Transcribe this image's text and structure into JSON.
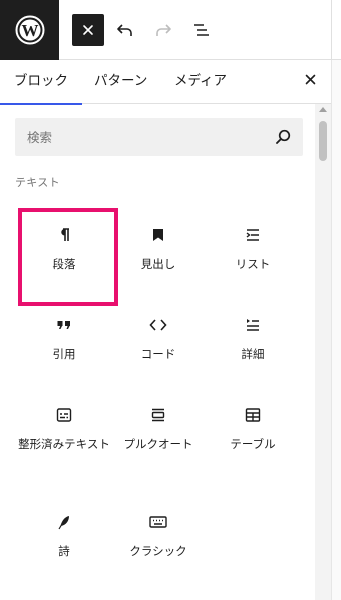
{
  "toolbar": {
    "logo_icon": "wordpress-logo-icon",
    "close_icon": "close-icon",
    "undo_icon": "undo-icon",
    "redo_icon": "redo-icon",
    "list_view_icon": "list-view-icon"
  },
  "tabs": [
    {
      "label": "ブロック",
      "active": true
    },
    {
      "label": "パターン",
      "active": false
    },
    {
      "label": "メディア",
      "active": false
    }
  ],
  "search": {
    "placeholder": "検索",
    "icon": "search-icon"
  },
  "category_label": "テキスト",
  "blocks": [
    {
      "label": "段落",
      "icon": "paragraph-icon",
      "selected": true
    },
    {
      "label": "見出し",
      "icon": "heading-bookmark-icon"
    },
    {
      "label": "リスト",
      "icon": "list-icon"
    },
    {
      "label": "引用",
      "icon": "quote-icon"
    },
    {
      "label": "コード",
      "icon": "code-icon"
    },
    {
      "label": "詳細",
      "icon": "details-icon"
    },
    {
      "label": "整形済みテキスト",
      "icon": "preformatted-icon"
    },
    {
      "label": "プルクオート",
      "icon": "pullquote-icon"
    },
    {
      "label": "テーブル",
      "icon": "table-icon"
    },
    {
      "label": "詩",
      "icon": "verse-icon"
    },
    {
      "label": "クラシック",
      "icon": "classic-keyboard-icon"
    }
  ],
  "colors": {
    "accent": "#3858e9",
    "selection": "#e8106e",
    "dark": "#1e1e1e"
  }
}
